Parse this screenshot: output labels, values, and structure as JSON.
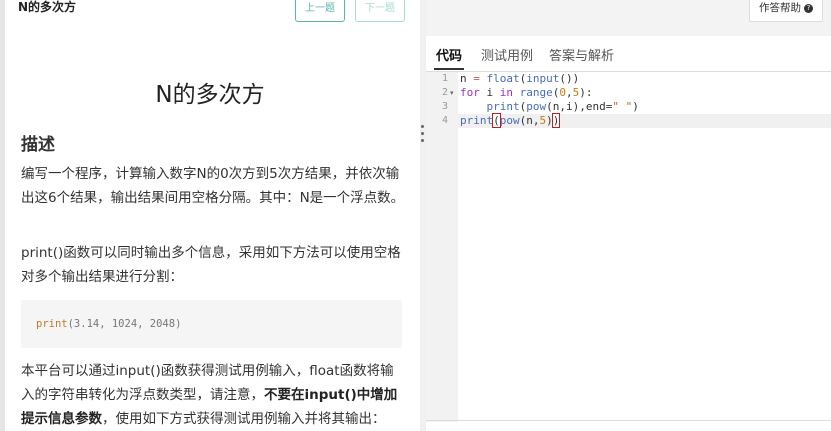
{
  "header": {
    "title": "N的多次方",
    "prev_label": "上一题",
    "next_label": "下一题"
  },
  "problem": {
    "title": "N的多次方",
    "section_heading": "描述",
    "para1": "编写一个程序，计算输入数字N的0次方到5次方结果，并依次输出这6个结果，输出结果间用空格分隔。其中：N是一个浮点数。",
    "para2": "print()函数可以同时输出多个信息，采用如下方法可以使用空格对多个输出结果进行分割：",
    "code_sample": {
      "fn": "print",
      "args": "(3.14, 1024, 2048)"
    },
    "para3_a": "本平台可以通过input()函数获得测试用例输入，float函数将输入的字符串转化为浮点数类型，请注意，",
    "para3_bold": "不要在input()中增加提示信息参数",
    "para3_b": "，使用如下方式获得测试用例输入并将其输出："
  },
  "right_panel": {
    "help_label": "作答帮助",
    "help_icon": "?",
    "tabs": [
      {
        "label": "代码",
        "active": true
      },
      {
        "label": "测试用例",
        "active": false
      },
      {
        "label": "答案与解析",
        "active": false
      }
    ]
  },
  "editor": {
    "line_numbers": [
      "1",
      "2",
      "3",
      "4"
    ],
    "fold_marker": "▾",
    "lines": [
      "n = float(input())",
      "for i in range(0,5):",
      "    print(pow(n,i),end=\" \")",
      "print(pow(n,5))"
    ]
  }
}
